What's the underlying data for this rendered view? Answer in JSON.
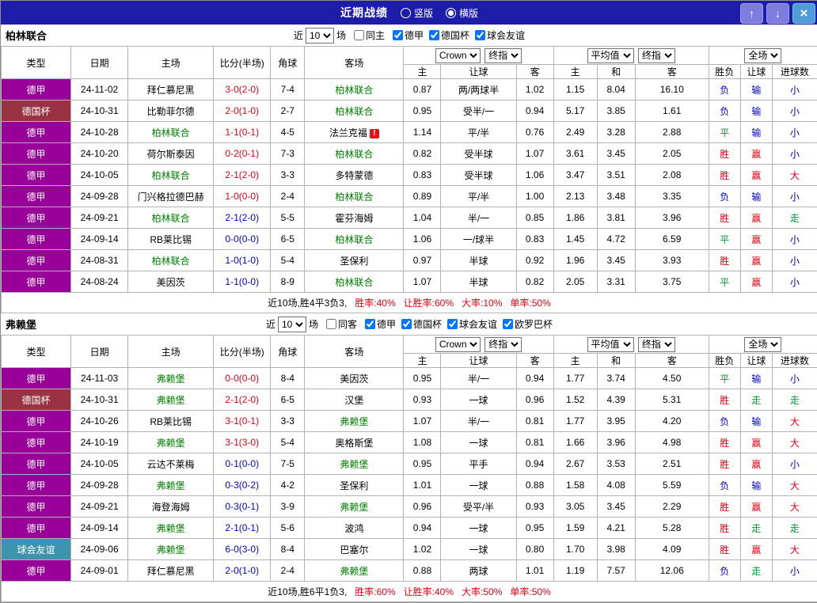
{
  "topbar": {
    "title": "近期战绩",
    "radios": [
      {
        "label": "竖版",
        "selected": false
      },
      {
        "label": "横版",
        "selected": true
      }
    ],
    "buttons": {
      "up": "↑",
      "down": "↓",
      "close": "×"
    }
  },
  "table_headers": {
    "left": [
      "类型",
      "日期",
      "主场",
      "比分(半场)",
      "角球",
      "客场"
    ],
    "odds_sub": [
      "主",
      "让球",
      "客"
    ],
    "avg_sub": [
      "主",
      "和",
      "客"
    ],
    "result_sub": [
      "胜负",
      "让球",
      "进球数"
    ]
  },
  "colors": {
    "topbar_bg": "#1d1daa",
    "league_purple": "#990099",
    "cup_maroon": "#993344",
    "friendly_teal": "#3e93ae",
    "team_green": "#008000",
    "win_red": "#e60012",
    "lose_blue": "#0000d9",
    "draw_green": "#009933"
  },
  "sections": [
    {
      "team": "柏林联合",
      "filter": {
        "near": "近",
        "count": "10",
        "games": "场",
        "same": "同主",
        "same_checked": false,
        "leagues": [
          {
            "label": "德甲",
            "checked": true
          },
          {
            "label": "德国杯",
            "checked": true
          },
          {
            "label": "球会友谊",
            "checked": true
          }
        ]
      },
      "selects": {
        "company": "Crown",
        "stage": "终指",
        "average": "平均值",
        "average_stage": "终指",
        "scope": "全场"
      },
      "rows": [
        {
          "type": "德甲",
          "tc": "dejia",
          "date": "24-11-02",
          "home": "拜仁慕尼黑",
          "hg": false,
          "score": "3-0(2-0)",
          "sc": "red",
          "corner": "7-4",
          "away": "柏林联合",
          "ag": true,
          "flag": false,
          "w1": "0.87",
          "hc": "两/两球半",
          "w2": "1.02",
          "e1": "1.15",
          "e2": "8.04",
          "e3": "16.10",
          "r": "负",
          "hr": "输",
          "gr": "小"
        },
        {
          "type": "德国杯",
          "tc": "deguobei",
          "date": "24-10-31",
          "home": "比勒菲尔德",
          "hg": false,
          "score": "2-0(1-0)",
          "sc": "red",
          "corner": "2-7",
          "away": "柏林联合",
          "ag": true,
          "flag": false,
          "w1": "0.95",
          "hc": "受半/一",
          "w2": "0.94",
          "e1": "5.17",
          "e2": "3.85",
          "e3": "1.61",
          "r": "负",
          "hr": "输",
          "gr": "小"
        },
        {
          "type": "德甲",
          "tc": "dejia",
          "date": "24-10-28",
          "home": "柏林联合",
          "hg": true,
          "score": "1-1(0-1)",
          "sc": "red",
          "corner": "4-5",
          "away": "法兰克福",
          "ag": false,
          "flag": true,
          "w1": "1.14",
          "hc": "平/半",
          "w2": "0.76",
          "e1": "2.49",
          "e2": "3.28",
          "e3": "2.88",
          "r": "平",
          "hr": "输",
          "gr": "小"
        },
        {
          "type": "德甲",
          "tc": "dejia",
          "date": "24-10-20",
          "home": "荷尔斯泰因",
          "hg": false,
          "score": "0-2(0-1)",
          "sc": "red",
          "corner": "7-3",
          "away": "柏林联合",
          "ag": true,
          "flag": false,
          "w1": "0.82",
          "hc": "受半球",
          "w2": "1.07",
          "e1": "3.61",
          "e2": "3.45",
          "e3": "2.05",
          "r": "胜",
          "hr": "赢",
          "gr": "小"
        },
        {
          "type": "德甲",
          "tc": "dejia",
          "date": "24-10-05",
          "home": "柏林联合",
          "hg": true,
          "score": "2-1(2-0)",
          "sc": "red",
          "corner": "3-3",
          "away": "多特蒙德",
          "ag": false,
          "flag": false,
          "w1": "0.83",
          "hc": "受半球",
          "w2": "1.06",
          "e1": "3.47",
          "e2": "3.51",
          "e3": "2.08",
          "r": "胜",
          "hr": "赢",
          "gr": "大"
        },
        {
          "type": "德甲",
          "tc": "dejia",
          "date": "24-09-28",
          "home": "门兴格拉德巴赫",
          "hg": false,
          "score": "1-0(0-0)",
          "sc": "red",
          "corner": "2-4",
          "away": "柏林联合",
          "ag": true,
          "flag": false,
          "w1": "0.89",
          "hc": "平/半",
          "w2": "1.00",
          "e1": "2.13",
          "e2": "3.48",
          "e3": "3.35",
          "r": "负",
          "hr": "输",
          "gr": "小"
        },
        {
          "type": "德甲",
          "tc": "dejia",
          "date": "24-09-21",
          "home": "柏林联合",
          "hg": true,
          "score": "2-1(2-0)",
          "sc": "blue",
          "corner": "5-5",
          "away": "霍芬海姆",
          "ag": false,
          "flag": false,
          "w1": "1.04",
          "hc": "半/一",
          "w2": "0.85",
          "e1": "1.86",
          "e2": "3.81",
          "e3": "3.96",
          "r": "胜",
          "hr": "赢",
          "gr": "走"
        },
        {
          "type": "德甲",
          "tc": "dejia",
          "date": "24-09-14",
          "home": "RB莱比锡",
          "hg": false,
          "score": "0-0(0-0)",
          "sc": "blue",
          "corner": "6-5",
          "away": "柏林联合",
          "ag": true,
          "flag": false,
          "w1": "1.06",
          "hc": "一/球半",
          "w2": "0.83",
          "e1": "1.45",
          "e2": "4.72",
          "e3": "6.59",
          "r": "平",
          "hr": "赢",
          "gr": "小"
        },
        {
          "type": "德甲",
          "tc": "dejia",
          "date": "24-08-31",
          "home": "柏林联合",
          "hg": true,
          "score": "1-0(1-0)",
          "sc": "blue",
          "corner": "5-4",
          "away": "圣保利",
          "ag": false,
          "flag": false,
          "w1": "0.97",
          "hc": "半球",
          "w2": "0.92",
          "e1": "1.96",
          "e2": "3.45",
          "e3": "3.93",
          "r": "胜",
          "hr": "赢",
          "gr": "小"
        },
        {
          "type": "德甲",
          "tc": "dejia",
          "date": "24-08-24",
          "home": "美因茨",
          "hg": false,
          "score": "1-1(0-0)",
          "sc": "blue",
          "corner": "8-9",
          "away": "柏林联合",
          "ag": true,
          "flag": false,
          "w1": "1.07",
          "hc": "半球",
          "w2": "0.82",
          "e1": "2.05",
          "e2": "3.31",
          "e3": "3.75",
          "r": "平",
          "hr": "赢",
          "gr": "小"
        }
      ],
      "summary": {
        "prefix": "近10场,胜4平3负3,",
        "stats": [
          "胜率:40%",
          "让胜率:60%",
          "大率:10%",
          "单率:50%"
        ]
      }
    },
    {
      "team": "弗赖堡",
      "filter": {
        "near": "近",
        "count": "10",
        "games": "场",
        "same": "同客",
        "same_checked": false,
        "leagues": [
          {
            "label": "德甲",
            "checked": true
          },
          {
            "label": "德国杯",
            "checked": true
          },
          {
            "label": "球会友谊",
            "checked": true
          },
          {
            "label": "欧罗巴杯",
            "checked": true
          }
        ]
      },
      "selects": {
        "company": "Crown",
        "stage": "终指",
        "average": "平均值",
        "average_stage": "终指",
        "scope": "全场"
      },
      "rows": [
        {
          "type": "德甲",
          "tc": "dejia",
          "date": "24-11-03",
          "home": "弗赖堡",
          "hg": true,
          "score": "0-0(0-0)",
          "sc": "red",
          "corner": "8-4",
          "away": "美因茨",
          "ag": false,
          "flag": false,
          "w1": "0.95",
          "hc": "半/一",
          "w2": "0.94",
          "e1": "1.77",
          "e2": "3.74",
          "e3": "4.50",
          "r": "平",
          "hr": "输",
          "gr": "小"
        },
        {
          "type": "德国杯",
          "tc": "deguobei",
          "date": "24-10-31",
          "home": "弗赖堡",
          "hg": true,
          "score": "2-1(2-0)",
          "sc": "red",
          "corner": "6-5",
          "away": "汉堡",
          "ag": false,
          "flag": false,
          "w1": "0.93",
          "hc": "一球",
          "w2": "0.96",
          "e1": "1.52",
          "e2": "4.39",
          "e3": "5.31",
          "r": "胜",
          "hr": "走",
          "gr": "走"
        },
        {
          "type": "德甲",
          "tc": "dejia",
          "date": "24-10-26",
          "home": "RB莱比锡",
          "hg": false,
          "score": "3-1(0-1)",
          "sc": "red",
          "corner": "3-3",
          "away": "弗赖堡",
          "ag": true,
          "flag": false,
          "w1": "1.07",
          "hc": "半/一",
          "w2": "0.81",
          "e1": "1.77",
          "e2": "3.95",
          "e3": "4.20",
          "r": "负",
          "hr": "输",
          "gr": "大"
        },
        {
          "type": "德甲",
          "tc": "dejia",
          "date": "24-10-19",
          "home": "弗赖堡",
          "hg": true,
          "score": "3-1(3-0)",
          "sc": "red",
          "corner": "5-4",
          "away": "奥格斯堡",
          "ag": false,
          "flag": false,
          "w1": "1.08",
          "hc": "一球",
          "w2": "0.81",
          "e1": "1.66",
          "e2": "3.96",
          "e3": "4.98",
          "r": "胜",
          "hr": "赢",
          "gr": "大"
        },
        {
          "type": "德甲",
          "tc": "dejia",
          "date": "24-10-05",
          "home": "云达不莱梅",
          "hg": false,
          "score": "0-1(0-0)",
          "sc": "blue",
          "corner": "7-5",
          "away": "弗赖堡",
          "ag": true,
          "flag": false,
          "w1": "0.95",
          "hc": "平手",
          "w2": "0.94",
          "e1": "2.67",
          "e2": "3.53",
          "e3": "2.51",
          "r": "胜",
          "hr": "赢",
          "gr": "小"
        },
        {
          "type": "德甲",
          "tc": "dejia",
          "date": "24-09-28",
          "home": "弗赖堡",
          "hg": true,
          "score": "0-3(0-2)",
          "sc": "blue",
          "corner": "4-2",
          "away": "圣保利",
          "ag": false,
          "flag": false,
          "w1": "1.01",
          "hc": "一球",
          "w2": "0.88",
          "e1": "1.58",
          "e2": "4.08",
          "e3": "5.59",
          "r": "负",
          "hr": "输",
          "gr": "大"
        },
        {
          "type": "德甲",
          "tc": "dejia",
          "date": "24-09-21",
          "home": "海登海姆",
          "hg": false,
          "score": "0-3(0-1)",
          "sc": "blue",
          "corner": "3-9",
          "away": "弗赖堡",
          "ag": true,
          "flag": false,
          "w1": "0.96",
          "hc": "受平/半",
          "w2": "0.93",
          "e1": "3.05",
          "e2": "3.45",
          "e3": "2.29",
          "r": "胜",
          "hr": "赢",
          "gr": "大"
        },
        {
          "type": "德甲",
          "tc": "dejia",
          "date": "24-09-14",
          "home": "弗赖堡",
          "hg": true,
          "score": "2-1(0-1)",
          "sc": "blue",
          "corner": "5-6",
          "away": "波鸿",
          "ag": false,
          "flag": false,
          "w1": "0.94",
          "hc": "一球",
          "w2": "0.95",
          "e1": "1.59",
          "e2": "4.21",
          "e3": "5.28",
          "r": "胜",
          "hr": "走",
          "gr": "走"
        },
        {
          "type": "球会友谊",
          "tc": "youyi",
          "date": "24-09-06",
          "home": "弗赖堡",
          "hg": true,
          "score": "6-0(3-0)",
          "sc": "blue",
          "corner": "8-4",
          "away": "巴塞尔",
          "ag": false,
          "flag": false,
          "w1": "1.02",
          "hc": "一球",
          "w2": "0.80",
          "e1": "1.70",
          "e2": "3.98",
          "e3": "4.09",
          "r": "胜",
          "hr": "赢",
          "gr": "大"
        },
        {
          "type": "德甲",
          "tc": "dejia",
          "date": "24-09-01",
          "home": "拜仁慕尼黑",
          "hg": false,
          "score": "2-0(1-0)",
          "sc": "blue",
          "corner": "2-4",
          "away": "弗赖堡",
          "ag": true,
          "flag": false,
          "w1": "0.88",
          "hc": "两球",
          "w2": "1.01",
          "e1": "1.19",
          "e2": "7.57",
          "e3": "12.06",
          "r": "负",
          "hr": "走",
          "gr": "小"
        }
      ],
      "summary": {
        "prefix": "近10场,胜6平1负3,",
        "stats": [
          "胜率:60%",
          "让胜率:40%",
          "大率:50%",
          "单率:50%"
        ]
      }
    }
  ]
}
